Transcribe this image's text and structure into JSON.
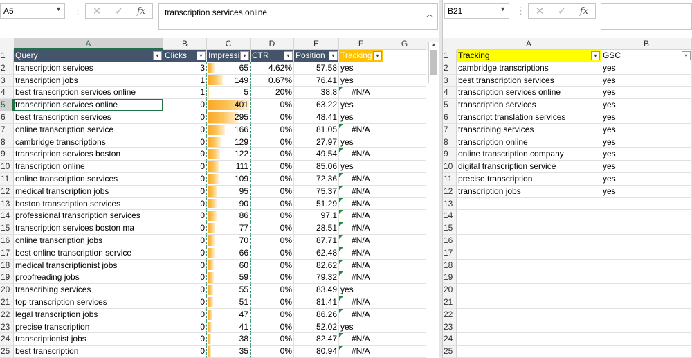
{
  "left": {
    "namebox": "A5",
    "formula": "transcription services online",
    "col_labels": [
      "A",
      "B",
      "C",
      "D",
      "E",
      "F",
      "G"
    ],
    "header_row": {
      "num": "1",
      "query": "Query",
      "clicks": "Clicks",
      "impressions": "Impressi",
      "ctr": "CTR",
      "position": "Position",
      "tracking": "Tracking"
    },
    "rows": [
      {
        "n": "2",
        "query": "transcription services",
        "clicks": "3",
        "imp": "65",
        "imp_fill": 0.16,
        "ctr": "4.62%",
        "pos": "57.58",
        "track": "yes",
        "tri": false
      },
      {
        "n": "3",
        "query": "transcription jobs",
        "clicks": "1",
        "imp": "149",
        "imp_fill": 0.37,
        "ctr": "0.67%",
        "pos": "76.41",
        "track": "yes",
        "tri": false
      },
      {
        "n": "4",
        "query": "best transcription services online",
        "clicks": "1",
        "imp": "5",
        "imp_fill": 0.01,
        "ctr": "20%",
        "pos": "38.8",
        "track": "#N/A",
        "tri": true
      },
      {
        "n": "5",
        "query": "transcription services online",
        "clicks": "0",
        "imp": "401",
        "imp_fill": 1.0,
        "ctr": "0%",
        "pos": "63.22",
        "track": "yes",
        "tri": false
      },
      {
        "n": "6",
        "query": "best transcription services",
        "clicks": "0",
        "imp": "295",
        "imp_fill": 0.74,
        "ctr": "0%",
        "pos": "48.41",
        "track": "yes",
        "tri": false
      },
      {
        "n": "7",
        "query": "online transcription service",
        "clicks": "0",
        "imp": "166",
        "imp_fill": 0.41,
        "ctr": "0%",
        "pos": "81.05",
        "track": "#N/A",
        "tri": true
      },
      {
        "n": "8",
        "query": "cambridge transcriptions",
        "clicks": "0",
        "imp": "129",
        "imp_fill": 0.32,
        "ctr": "0%",
        "pos": "27.97",
        "track": "yes",
        "tri": false
      },
      {
        "n": "9",
        "query": "transcription services boston",
        "clicks": "0",
        "imp": "122",
        "imp_fill": 0.3,
        "ctr": "0%",
        "pos": "49.54",
        "track": "#N/A",
        "tri": true
      },
      {
        "n": "10",
        "query": "transcription online",
        "clicks": "0",
        "imp": "111",
        "imp_fill": 0.28,
        "ctr": "0%",
        "pos": "85.06",
        "track": "yes",
        "tri": false
      },
      {
        "n": "11",
        "query": "online transcription services",
        "clicks": "0",
        "imp": "109",
        "imp_fill": 0.27,
        "ctr": "0%",
        "pos": "72.36",
        "track": "#N/A",
        "tri": true
      },
      {
        "n": "12",
        "query": "medical transcription jobs",
        "clicks": "0",
        "imp": "95",
        "imp_fill": 0.24,
        "ctr": "0%",
        "pos": "75.37",
        "track": "#N/A",
        "tri": true
      },
      {
        "n": "13",
        "query": "boston transcription services",
        "clicks": "0",
        "imp": "90",
        "imp_fill": 0.22,
        "ctr": "0%",
        "pos": "51.29",
        "track": "#N/A",
        "tri": true
      },
      {
        "n": "14",
        "query": "professional transcription services",
        "clicks": "0",
        "imp": "86",
        "imp_fill": 0.21,
        "ctr": "0%",
        "pos": "97.1",
        "track": "#N/A",
        "tri": true
      },
      {
        "n": "15",
        "query": "transcription services boston ma",
        "clicks": "0",
        "imp": "77",
        "imp_fill": 0.19,
        "ctr": "0%",
        "pos": "28.51",
        "track": "#N/A",
        "tri": true
      },
      {
        "n": "16",
        "query": "online transcription jobs",
        "clicks": "0",
        "imp": "70",
        "imp_fill": 0.17,
        "ctr": "0%",
        "pos": "87.71",
        "track": "#N/A",
        "tri": true
      },
      {
        "n": "17",
        "query": "best online transcription service",
        "clicks": "0",
        "imp": "66",
        "imp_fill": 0.16,
        "ctr": "0%",
        "pos": "62.48",
        "track": "#N/A",
        "tri": true
      },
      {
        "n": "18",
        "query": "medical transcriptionist jobs",
        "clicks": "0",
        "imp": "60",
        "imp_fill": 0.15,
        "ctr": "0%",
        "pos": "82.62",
        "track": "#N/A",
        "tri": true
      },
      {
        "n": "19",
        "query": "proofreading jobs",
        "clicks": "0",
        "imp": "59",
        "imp_fill": 0.15,
        "ctr": "0%",
        "pos": "79.32",
        "track": "#N/A",
        "tri": true
      },
      {
        "n": "20",
        "query": "transcribing services",
        "clicks": "0",
        "imp": "55",
        "imp_fill": 0.14,
        "ctr": "0%",
        "pos": "83.49",
        "track": "yes",
        "tri": false
      },
      {
        "n": "21",
        "query": "top transcription services",
        "clicks": "0",
        "imp": "51",
        "imp_fill": 0.13,
        "ctr": "0%",
        "pos": "81.41",
        "track": "#N/A",
        "tri": true
      },
      {
        "n": "22",
        "query": "legal transcription jobs",
        "clicks": "0",
        "imp": "47",
        "imp_fill": 0.12,
        "ctr": "0%",
        "pos": "86.26",
        "track": "#N/A",
        "tri": true
      },
      {
        "n": "23",
        "query": "precise transcription",
        "clicks": "0",
        "imp": "41",
        "imp_fill": 0.1,
        "ctr": "0%",
        "pos": "52.02",
        "track": "yes",
        "tri": false
      },
      {
        "n": "24",
        "query": "transcriptionist jobs",
        "clicks": "0",
        "imp": "38",
        "imp_fill": 0.09,
        "ctr": "0%",
        "pos": "82.47",
        "track": "#N/A",
        "tri": true
      },
      {
        "n": "25",
        "query": "best transcription",
        "clicks": "0",
        "imp": "35",
        "imp_fill": 0.09,
        "ctr": "0%",
        "pos": "80.94",
        "track": "#N/A",
        "tri": true
      }
    ]
  },
  "right": {
    "namebox": "B21",
    "col_labels": [
      "A",
      "B"
    ],
    "header_row": {
      "num": "1",
      "tracking": "Tracking",
      "gsc": "GSC"
    },
    "rows": [
      {
        "n": "2",
        "tracking": "cambridge transcriptions",
        "gsc": "yes"
      },
      {
        "n": "3",
        "tracking": "best transcription services",
        "gsc": "yes"
      },
      {
        "n": "4",
        "tracking": "transcription services online",
        "gsc": "yes"
      },
      {
        "n": "5",
        "tracking": "transcription services",
        "gsc": "yes"
      },
      {
        "n": "6",
        "tracking": "transcript translation services",
        "gsc": "yes"
      },
      {
        "n": "7",
        "tracking": "transcribing services",
        "gsc": "yes"
      },
      {
        "n": "8",
        "tracking": "transcription online",
        "gsc": "yes"
      },
      {
        "n": "9",
        "tracking": "online transcription company",
        "gsc": "yes"
      },
      {
        "n": "10",
        "tracking": "digital transcription service",
        "gsc": "yes"
      },
      {
        "n": "11",
        "tracking": "precise transcription",
        "gsc": "yes"
      },
      {
        "n": "12",
        "tracking": "transcription jobs",
        "gsc": "yes"
      },
      {
        "n": "13",
        "tracking": "",
        "gsc": ""
      },
      {
        "n": "14",
        "tracking": "",
        "gsc": ""
      },
      {
        "n": "15",
        "tracking": "",
        "gsc": ""
      },
      {
        "n": "16",
        "tracking": "",
        "gsc": ""
      },
      {
        "n": "17",
        "tracking": "",
        "gsc": ""
      },
      {
        "n": "18",
        "tracking": "",
        "gsc": ""
      },
      {
        "n": "19",
        "tracking": "",
        "gsc": ""
      },
      {
        "n": "20",
        "tracking": "",
        "gsc": ""
      },
      {
        "n": "21",
        "tracking": "",
        "gsc": ""
      },
      {
        "n": "22",
        "tracking": "",
        "gsc": ""
      },
      {
        "n": "23",
        "tracking": "",
        "gsc": ""
      },
      {
        "n": "24",
        "tracking": "",
        "gsc": ""
      },
      {
        "n": "25",
        "tracking": "",
        "gsc": ""
      }
    ]
  },
  "icons": {
    "cancel": "close-icon",
    "enter": "check-icon",
    "function": "fx-icon",
    "expand": "chevron-up-icon",
    "filter": "filter-dropdown-icon"
  },
  "colors": {
    "header_dark": "#44546a",
    "tracking_orange": "#ffc000",
    "tracking_yellow": "#ffff00",
    "databar": "#f9a825",
    "selection": "#217346"
  }
}
